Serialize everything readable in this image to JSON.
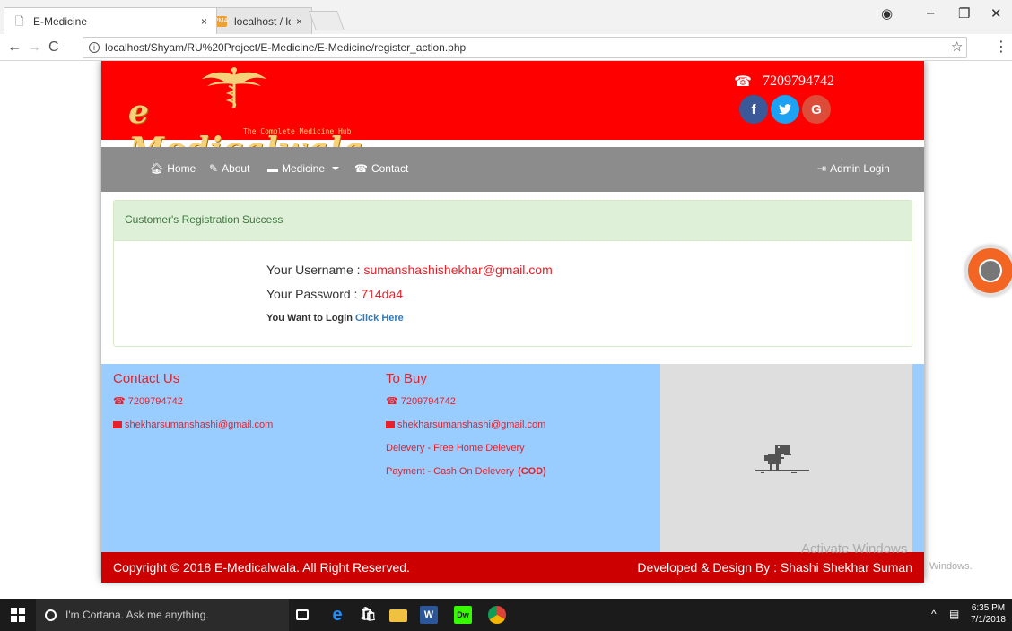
{
  "browser": {
    "tabs": [
      {
        "title": "E-Medicine",
        "close": "×"
      },
      {
        "title": "localhost / localhost / e_",
        "close": "×"
      }
    ],
    "url": "localhost/Shyam/RU%20Project/E-Medicine/E-Medicine/register_action.php"
  },
  "site": {
    "logo_text": "e Medicalwala",
    "logo_tagline": "The Complete Medicine Hub",
    "phone": "7209794742",
    "socials": [
      "f",
      "t",
      "G"
    ],
    "nav": {
      "home": "Home",
      "about": "About",
      "medicine": "Medicine",
      "contact": "Contact",
      "admin_login": "Admin Login"
    },
    "panel": {
      "heading": "Customer's Registration Success",
      "username_label": "Your Username : ",
      "username_value": "sumanshashishekhar@gmail.com",
      "password_label": "Your Password : ",
      "password_value": "714da4",
      "login_text": "You Want to Login ",
      "login_link": "Click Here"
    },
    "footer": {
      "contact_title": "Contact Us",
      "contact_phone": "7209794742",
      "contact_email": "shekharsumanshashi@gmail.com",
      "buy_title": "To Buy",
      "buy_phone": "7209794742",
      "buy_email": "shekharsumanshashi@gmail.com",
      "delivery": "Delevery - Free Home Delevery",
      "payment": "Payment - Cash On Delevery ",
      "payment_code": "(COD)"
    },
    "copyright": "Copyright © 2018 E-Medicalwala. All Right Reserved.",
    "developer": "Developed & Design By : Shashi Shekhar Suman"
  },
  "overlay": {
    "watermark": "Activate Windows",
    "watermark_sub": "Windows."
  },
  "taskbar": {
    "cortana_placeholder": "I'm Cortana. Ask me anything.",
    "time": "6:35 PM",
    "date": "7/1/2018"
  },
  "colors": {
    "header_red": "#ff0000",
    "nav_gray": "#8c8c8c",
    "footer_blue": "#99ccff",
    "copyright_red": "#cc0000",
    "success_green_bg": "#dff0d8",
    "value_red": "#e8202a",
    "link_blue": "#337ab7"
  }
}
